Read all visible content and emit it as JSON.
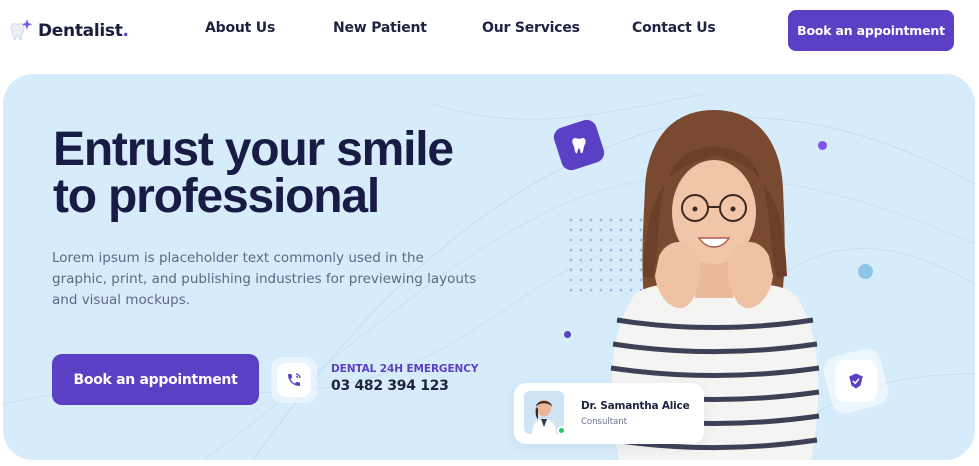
{
  "brand": {
    "name": "Dentalist",
    "dot": ".",
    "accent": "#5b3fc4"
  },
  "nav": {
    "items": [
      {
        "label": "About Us"
      },
      {
        "label": "New Patient"
      },
      {
        "label": "Our Services"
      },
      {
        "label": "Contact Us"
      }
    ],
    "cta_label": "Book an appointment"
  },
  "hero": {
    "headline_line1": "Entrust your smile",
    "headline_line2": "to professional",
    "subtext": "Lorem ipsum is placeholder text commonly used in the graphic, print, and publishing industries for previewing layouts and visual mockups.",
    "cta_label": "Book an appointment",
    "emergency_label": "DENTAL 24H EMERGENCY",
    "emergency_phone": "03 482 394 123"
  },
  "doctor": {
    "name": "Dr. Samantha Alice",
    "role": "Consultant",
    "status_color": "#29c36a"
  },
  "icons": [
    "tooth-logo-icon",
    "sparkle-icon",
    "tooth-icon",
    "phone-icon",
    "shield-check-icon"
  ],
  "colors": {
    "hero_bg": "#d7ecfa",
    "heading": "#181c44",
    "body_text": "#5f6786"
  }
}
